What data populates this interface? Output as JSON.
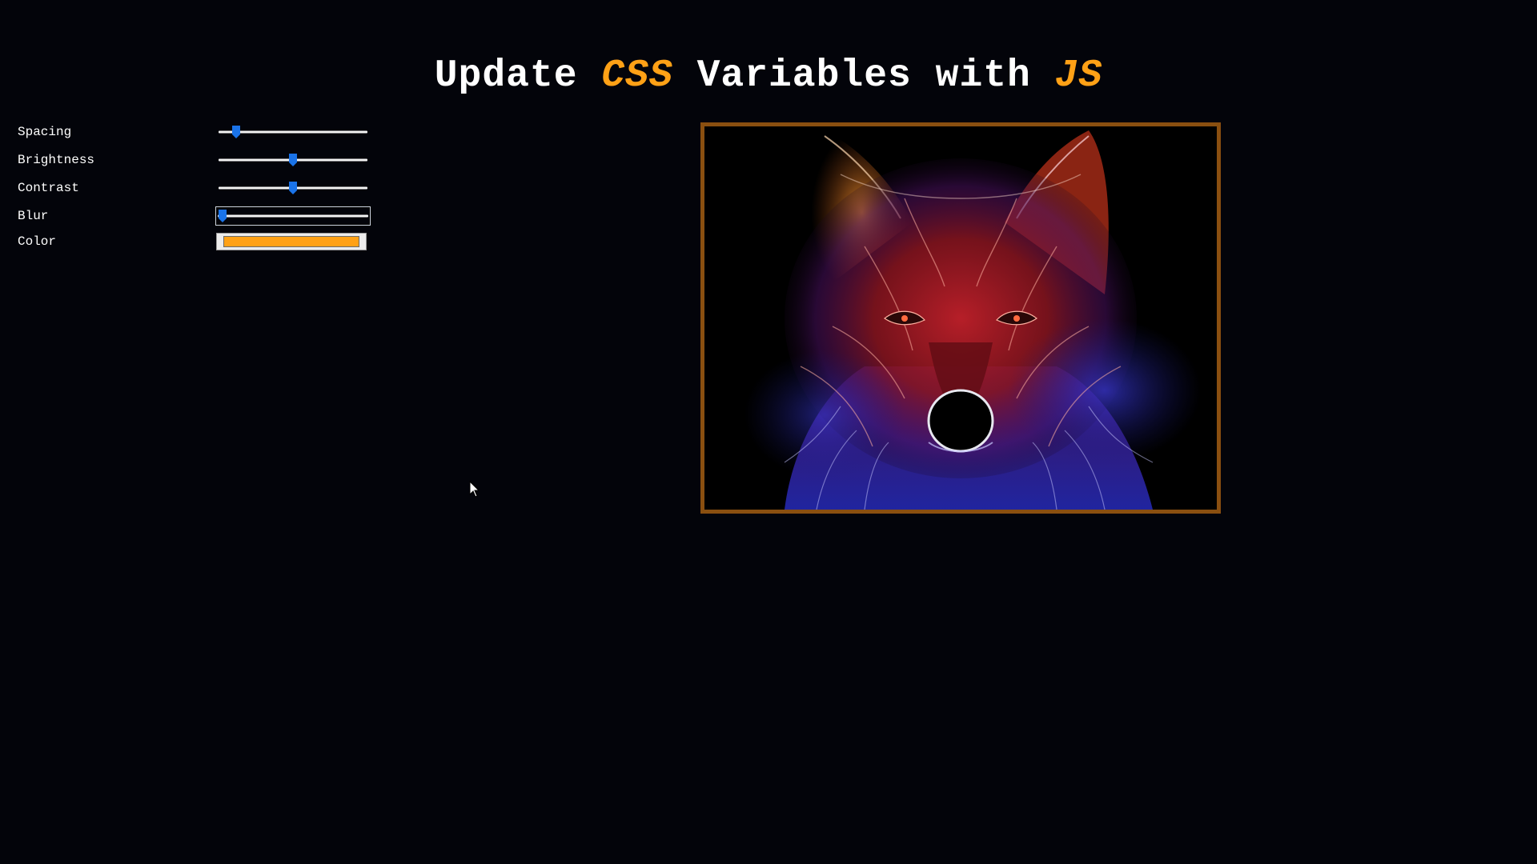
{
  "title": {
    "part1": "Update ",
    "highlight1": "CSS",
    "part2": " Variables with ",
    "highlight2": "JS"
  },
  "controls": [
    {
      "label": "Spacing",
      "type": "range",
      "value_fraction": 0.09
    },
    {
      "label": "Brightness",
      "type": "range",
      "value_fraction": 0.5
    },
    {
      "label": "Contrast",
      "type": "range",
      "value_fraction": 0.5
    },
    {
      "label": "Blur",
      "type": "range",
      "value_fraction": 0.0,
      "focused": true
    },
    {
      "label": "Color",
      "type": "color",
      "value": "#ffa116"
    }
  ],
  "image": {
    "name": "wolf-image",
    "border_color": "#8a4f10"
  },
  "colors": {
    "background": "#03040a",
    "accent": "#ffa116",
    "slider_thumb": "#1a73e8"
  }
}
